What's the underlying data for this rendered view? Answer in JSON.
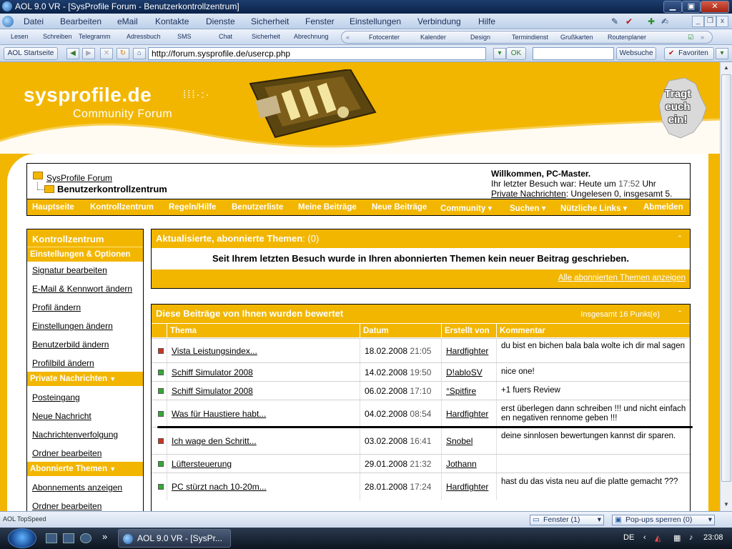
{
  "window": {
    "title": "AOL 9.0 VR - [SysProfile Forum - Benutzerkontrollzentrum]"
  },
  "menu": [
    "Datei",
    "Bearbeiten",
    "eMail",
    "Kontakte",
    "Dienste",
    "Sicherheit",
    "Fenster",
    "Einstellungen",
    "Verbindung",
    "Hilfe"
  ],
  "toolbar": {
    "items": [
      "Lesen",
      "Schreiben",
      "Telegramm",
      "Adressbuch",
      "SMS",
      "Chat",
      "Sicherheit",
      "Abrechnung"
    ],
    "quick": [
      "Fotocenter",
      "Kalender",
      "Design",
      "Termindienst",
      "Grußkarten",
      "Routenplaner"
    ]
  },
  "address": {
    "home_label": "AOL Startseite",
    "url": "http://forum.sysprofile.de/usercp.php",
    "ok_label": "OK",
    "websuche_label": "Websuche",
    "favoriten_label": "Favoriten"
  },
  "header": {
    "brand_bold": "sys",
    "brand_rest": "profile.de",
    "sub": "Community Forum",
    "badge": [
      "Tragt",
      "euch",
      "ein!"
    ]
  },
  "breadcrumb": {
    "forum": "SysProfile Forum",
    "current": "Benutzerkontrollzentrum"
  },
  "welcome": {
    "line1": "Willkommen, PC-Master.",
    "line2_prefix": "Ihr letzter Besuch war: Heute um ",
    "line2_time": "17:52",
    "line2_suffix": " Uhr",
    "pm_link": "Private Nachrichten",
    "pm_text": ": Ungelesen 0, insgesamt 5."
  },
  "nav": [
    "Hauptseite",
    "Kontrollzentrum",
    "Regeln/Hilfe",
    "Benutzerliste",
    "Meine Beiträge",
    "Neue Beiträge",
    "Community ▾",
    "Suchen ▾",
    "Nützliche Links ▾",
    "Abmelden"
  ],
  "sidebar": {
    "title": "Kontrollzentrum",
    "section1": "Einstellungen & Optionen",
    "items1": [
      "Signatur bearbeiten",
      "E-Mail & Kennwort ändern",
      "Profil ändern",
      "Einstellungen ändern",
      "Benutzerbild ändern",
      "Profilbild ändern"
    ],
    "section2": "Private Nachrichten",
    "items2": [
      "Posteingang",
      "Neue Nachricht",
      "Nachrichtenverfolgung",
      "Ordner bearbeiten"
    ],
    "section3": "Abonnierte Themen",
    "items3": [
      "Abonnements anzeigen",
      "Ordner bearbeiten"
    ]
  },
  "panel1": {
    "title": "Aktualisierte, abonnierte Themen",
    "count": ": (0)",
    "message": "Seit Ihrem letzten Besuch wurde in Ihren abonnierten Themen kein neuer Beitrag geschrieben.",
    "footer_link": "Alle abonnierten Themen anzeigen"
  },
  "panel2": {
    "title": "Diese Beiträge von Ihnen wurden bewertet",
    "total": "Insgesamt 16 Punkt(e)",
    "columns": [
      "Thema",
      "Datum",
      "Erstellt von",
      "Kommentar"
    ],
    "rows": [
      {
        "status": "#cc3322",
        "thema": "Vista Leistungsindex...",
        "date": "18.02.2008",
        "time": "21:05",
        "user": "Hardfighter",
        "comment": "du bist en bichen bala bala wolte ich dir mal sagen"
      },
      {
        "status": "#33aa33",
        "thema": "Schiff Simulator 2008",
        "date": "14.02.2008",
        "time": "19:50",
        "user": "D!abloSV",
        "comment": "nice one!"
      },
      {
        "status": "#33aa33",
        "thema": "Schiff Simulator 2008",
        "date": "06.02.2008",
        "time": "17:10",
        "user": "°Spitfire",
        "comment": "+1 fuers Review"
      },
      {
        "status": "#33aa33",
        "thema": "Was für Haustiere habt...",
        "date": "04.02.2008",
        "time": "08:54",
        "user": "Hardfighter",
        "comment": "erst überlegen dann schreiben !!! und nicht einfach en negativen rennome geben !!!"
      },
      {
        "status": "#cc3322",
        "thema": "Ich wage den Schritt...",
        "date": "03.02.2008",
        "time": "16:41",
        "user": "Snobel",
        "comment": "deine sinnlosen bewertungen kannst dir sparen."
      },
      {
        "status": "#33aa33",
        "thema": "Lüftersteuerung",
        "date": "29.01.2008",
        "time": "21:32",
        "user": "Jothann",
        "comment": ""
      },
      {
        "status": "#33aa33",
        "thema": "PC stürzt nach 10-20m...",
        "date": "28.01.2008",
        "time": "17:24",
        "user": "Hardfighter",
        "comment": "hast du das vista neu auf die platte gemacht ???"
      }
    ]
  },
  "statusbar": {
    "left": "AOL TopSpeed",
    "fenster": "Fenster (1)",
    "popups": "Pop-ups sperren (0)"
  },
  "taskbar": {
    "task": "AOL 9.0 VR - [SysPr...",
    "lang": "DE",
    "time": "23:08"
  }
}
